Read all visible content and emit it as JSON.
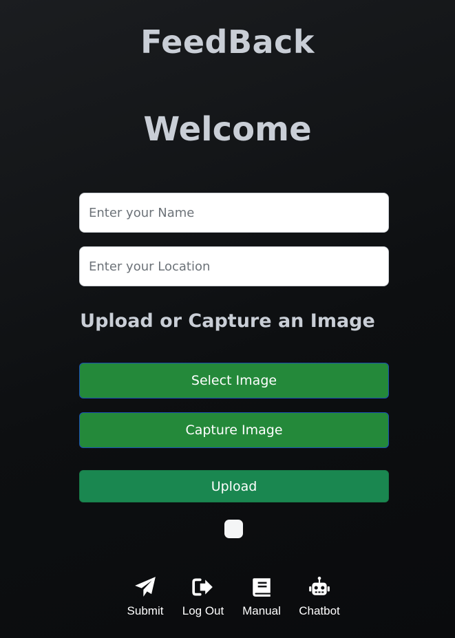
{
  "header": {
    "app_title": "FeedBack",
    "welcome": "Welcome"
  },
  "form": {
    "name_placeholder": "Enter your Name",
    "name_value": "",
    "location_placeholder": "Enter your Location",
    "location_value": ""
  },
  "upload": {
    "heading": "Upload or Capture an Image",
    "select_label": "Select Image",
    "capture_label": "Capture Image",
    "upload_label": "Upload"
  },
  "nav": {
    "items": [
      {
        "label": "Submit",
        "icon": "paper-plane-icon"
      },
      {
        "label": "Log Out",
        "icon": "sign-out-icon"
      },
      {
        "label": "Manual",
        "icon": "book-icon"
      },
      {
        "label": "Chatbot",
        "icon": "robot-icon"
      }
    ]
  },
  "colors": {
    "background": "#0d0f11",
    "heading_text": "#c9ced6",
    "primary_button": "#24893a",
    "upload_button": "#1a8750"
  }
}
